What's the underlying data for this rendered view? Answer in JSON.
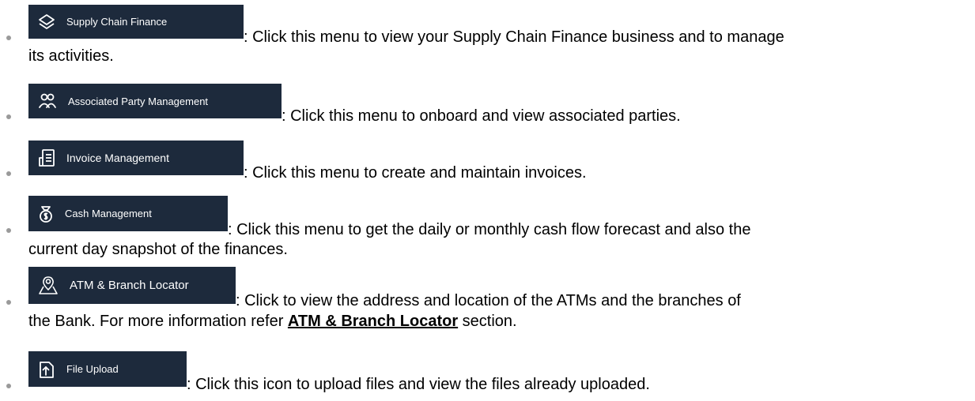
{
  "items": [
    {
      "menu_label": "Supply Chain Finance",
      "icon": "layers-icon",
      "text_line1": ":  Click this menu to view your Supply Chain Finance business and to manage",
      "text_line2": "its activities."
    },
    {
      "menu_label": "Associated Party Management",
      "icon": "users-icon",
      "text_line1": ": Click this menu to onboard and view associated parties."
    },
    {
      "menu_label": "Invoice Management",
      "icon": "invoice-icon",
      "text_line1": ": Click this menu to create and maintain invoices."
    },
    {
      "menu_label": "Cash Management",
      "icon": "money-bag-icon",
      "text_line1": ":  Click  this  menu  to  get  the  daily  or  monthly  cash  flow  forecast  and  also  the",
      "text_line2": "current day snapshot of the finances."
    },
    {
      "menu_label": "ATM & Branch Locator",
      "icon": "map-pin-icon",
      "text_line1": ":  Click  to  view  the  address  and  location  of  the  ATMs  and  the  branches  of",
      "text_line2_pre": "the Bank. For more information refer ",
      "text_line2_link": "ATM & Branch Locator",
      "text_line2_post": " section."
    },
    {
      "menu_label": "File Upload",
      "icon": "file-upload-icon",
      "text_line1": ": Click this icon to upload files and view the files already uploaded."
    }
  ],
  "colors": {
    "chip_bg": "#1d2a3c",
    "chip_text": "#ffffff",
    "bullet": "#9a9a9a"
  }
}
